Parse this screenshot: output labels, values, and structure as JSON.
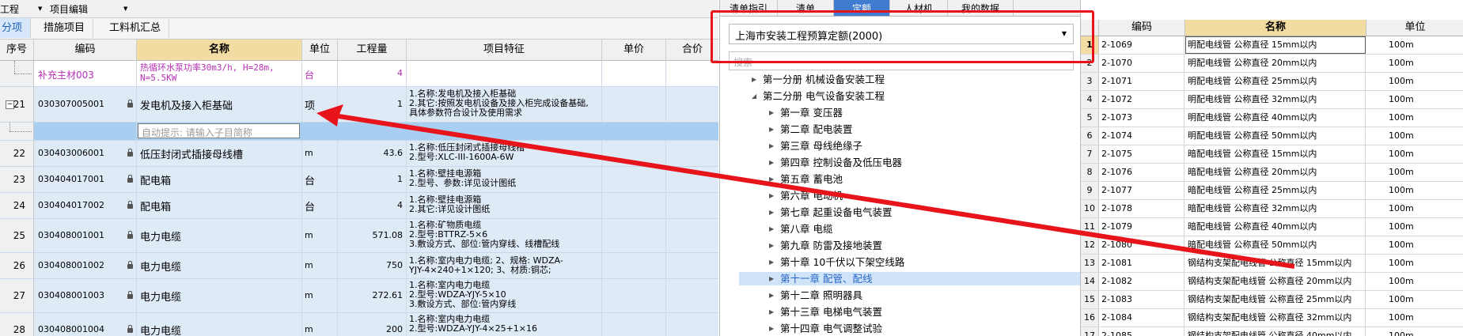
{
  "toolbar": {
    "item1": "工程",
    "item2": "项目编辑"
  },
  "tabs": [
    "分项",
    "措施项目",
    "工料机汇总"
  ],
  "grid": {
    "headers": {
      "seq": "序号",
      "code": "编码",
      "name": "名称",
      "unit": "单位",
      "qty": "工程量",
      "feature": "项目特征",
      "price": "单价",
      "total": "合价"
    },
    "sub_row": {
      "code": "补充主材003",
      "name": "热循环水泵功率30m3/h, H=28m, N=5.5KW",
      "unit": "台",
      "qty": "4"
    },
    "rows": [
      {
        "seq": "21",
        "code": "030307005001",
        "name": "发电机及接入柜基础",
        "unit": "项",
        "qty": "1",
        "feature": "1.名称:发电机及接入柜基础\n2.其它:按照发电机设备及接入柜完成设备基础,\n具体参数符合设计及使用需求"
      },
      {
        "seq": "22",
        "code": "030403006001",
        "name": "低压封闭式插接母线槽",
        "unit": "m",
        "qty": "43.6",
        "feature": "1.名称:低压封闭式插接母线槽\n2.型号:XLC-III-1600A-6W"
      },
      {
        "seq": "23",
        "code": "030404017001",
        "name": "配电箱",
        "unit": "台",
        "qty": "1",
        "feature": "1.名称:壁挂电源箱\n2.型号、参数:详见设计图纸"
      },
      {
        "seq": "24",
        "code": "030404017002",
        "name": "配电箱",
        "unit": "台",
        "qty": "4",
        "feature": "1.名称:壁挂电源箱\n2.其它:详见设计图纸"
      },
      {
        "seq": "25",
        "code": "030408001001",
        "name": "电力电缆",
        "unit": "m",
        "qty": "571.08",
        "feature": "1.名称:矿物质电缆\n2.型号:BTTRZ-5×6\n3.敷设方式、部位:管内穿线、线槽配线"
      },
      {
        "seq": "26",
        "code": "030408001002",
        "name": "电力电缆",
        "unit": "m",
        "qty": "750",
        "feature": "1.名称:室内电力电缆; 2、规格: WDZA-\nYJY-4×240+1×120; 3、材质:铜芯;"
      },
      {
        "seq": "27",
        "code": "030408001003",
        "name": "电力电缆",
        "unit": "m",
        "qty": "272.61",
        "feature": "1.名称:室内电力电缆\n2.型号:WDZA-YJY-5×10\n3.敷设方式、部位:管内穿线"
      },
      {
        "seq": "28",
        "code": "030408001004",
        "name": "电力电缆",
        "unit": "m",
        "qty": "200",
        "feature": "1.名称:室内电力电缆\n2.型号:WDZA-YJY-4×25+1×16"
      }
    ],
    "autocomplete_placeholder": "自动提示: 请输入子目简称"
  },
  "selector": {
    "tabs": [
      "清单指引",
      "清单",
      "定额",
      "人材机",
      "我的数据"
    ],
    "active_tab": 2,
    "library": "上海市安装工程预算定额(2000)",
    "search_placeholder": "搜索",
    "tree": [
      {
        "label": "第一分册 机械设备安装工程",
        "level": 0,
        "arrow": "▶"
      },
      {
        "label": "第二分册 电气设备安装工程",
        "level": 0,
        "arrow": "◢"
      },
      {
        "label": "第一章 变压器",
        "level": 1,
        "arrow": "▶"
      },
      {
        "label": "第二章 配电装置",
        "level": 1,
        "arrow": "▶"
      },
      {
        "label": "第三章 母线绝缘子",
        "level": 1,
        "arrow": "▶"
      },
      {
        "label": "第四章 控制设备及低压电器",
        "level": 1,
        "arrow": "▶"
      },
      {
        "label": "第五章 蓄电池",
        "level": 1,
        "arrow": "▶"
      },
      {
        "label": "第六章 电动机",
        "level": 1,
        "arrow": "▶"
      },
      {
        "label": "第七章 起重设备电气装置",
        "level": 1,
        "arrow": "▶"
      },
      {
        "label": "第八章 电缆",
        "level": 1,
        "arrow": "▶"
      },
      {
        "label": "第九章 防雷及接地装置",
        "level": 1,
        "arrow": "▶"
      },
      {
        "label": "第十章 10千伏以下架空线路",
        "level": 1,
        "arrow": "▶"
      },
      {
        "label": "第十一章 配管、配线",
        "level": 1,
        "arrow": "▶",
        "selected": true
      },
      {
        "label": "第十二章 照明器具",
        "level": 1,
        "arrow": "▶"
      },
      {
        "label": "第十三章 电梯电气装置",
        "level": 1,
        "arrow": "▶"
      },
      {
        "label": "第十四章 电气调整试验",
        "level": 1,
        "arrow": "▶"
      },
      {
        "label": "第三分册 热力设备安装工程",
        "level": 0,
        "arrow": "▶"
      }
    ]
  },
  "quota_table": {
    "headers": {
      "code": "编码",
      "name": "名称",
      "unit": "单位"
    },
    "rows": [
      {
        "n": "1",
        "code": "2-1069",
        "name": "明配电线管 公称直径 15mm以内",
        "unit": "100m"
      },
      {
        "n": "2",
        "code": "2-1070",
        "name": "明配电线管 公称直径 20mm以内",
        "unit": "100m"
      },
      {
        "n": "3",
        "code": "2-1071",
        "name": "明配电线管 公称直径 25mm以内",
        "unit": "100m"
      },
      {
        "n": "4",
        "code": "2-1072",
        "name": "明配电线管 公称直径 32mm以内",
        "unit": "100m"
      },
      {
        "n": "5",
        "code": "2-1073",
        "name": "明配电线管 公称直径 40mm以内",
        "unit": "100m"
      },
      {
        "n": "6",
        "code": "2-1074",
        "name": "明配电线管 公称直径 50mm以内",
        "unit": "100m"
      },
      {
        "n": "7",
        "code": "2-1075",
        "name": "暗配电线管 公称直径 15mm以内",
        "unit": "100m"
      },
      {
        "n": "8",
        "code": "2-1076",
        "name": "暗配电线管 公称直径 20mm以内",
        "unit": "100m"
      },
      {
        "n": "9",
        "code": "2-1077",
        "name": "暗配电线管 公称直径 25mm以内",
        "unit": "100m"
      },
      {
        "n": "10",
        "code": "2-1078",
        "name": "暗配电线管 公称直径 32mm以内",
        "unit": "100m"
      },
      {
        "n": "11",
        "code": "2-1079",
        "name": "暗配电线管 公称直径 40mm以内",
        "unit": "100m"
      },
      {
        "n": "12",
        "code": "2-1080",
        "name": "暗配电线管 公称直径 50mm以内",
        "unit": "100m"
      },
      {
        "n": "13",
        "code": "2-1081",
        "name": "钢结构支架配电线管 公称直径 15mm以内",
        "unit": "100m"
      },
      {
        "n": "14",
        "code": "2-1082",
        "name": "钢结构支架配电线管 公称直径 20mm以内",
        "unit": "100m"
      },
      {
        "n": "15",
        "code": "2-1083",
        "name": "钢结构支架配电线管 公称直径 25mm以内",
        "unit": "100m"
      },
      {
        "n": "16",
        "code": "2-1084",
        "name": "钢结构支架配电线管 公称直径 32mm以内",
        "unit": "100m"
      },
      {
        "n": "17",
        "code": "2-1085",
        "name": "钢结构支架配电线管 公称直径 40mm以内",
        "unit": "100m"
      }
    ]
  },
  "colors": {
    "annotation_red": "#e8141c",
    "active_tab_blue": "#3f7cd0",
    "name_header": "#f3dca1",
    "row_blue": "#dfeaf7"
  }
}
